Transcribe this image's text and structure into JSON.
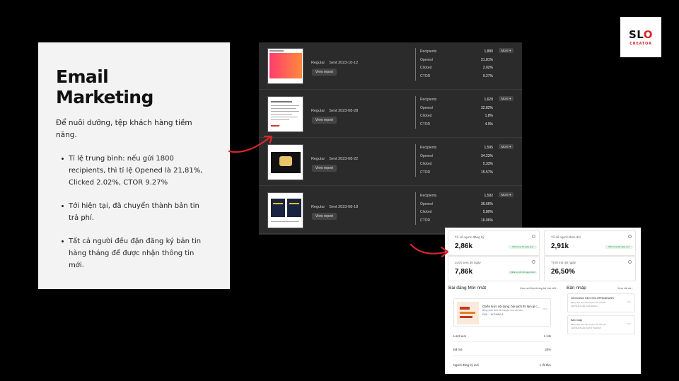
{
  "info": {
    "title": "Email Marketing",
    "subtitle": "Để nuôi dưỡng, tệp khách hàng tiềm năng.",
    "bullets": [
      "Tỉ lệ trung bình: nếu gửi 1800 recipients, thì tỉ lệ Opened là 21,81%, Clicked 2.02%, CTOR 9.27%",
      "Tới hiện tại, đã chuyển thành bản tin trả phí.",
      "Tất cả người đều đặn đăng ký bản tin hàng tháng để được nhận thông tin mới."
    ]
  },
  "logo": {
    "main_s": "S",
    "main_o": "O",
    "main_l": "L",
    "main_o2": "O",
    "sub": "CREATOR"
  },
  "colors": {
    "accent_red": "#d8262c",
    "panel_dark": "#2b2b2b",
    "badge_green": "#2a8a46"
  },
  "emails": {
    "type_label": "Regular",
    "view_label": "View report",
    "more_label": "More ▾",
    "stat_labels": [
      "Recipients",
      "Opened",
      "Clicked",
      "CTOR"
    ],
    "rows": [
      {
        "sent": "Sent 2023-10-12",
        "values": [
          "1,880",
          "21.81%",
          "2.02%",
          "9.27%"
        ]
      },
      {
        "sent": "Sent 2023-08-28",
        "values": [
          "1,628",
          "32.82%",
          "1.8%",
          "4.9%"
        ]
      },
      {
        "sent": "Sent 2023-08-22",
        "values": [
          "1,595",
          "34.23%",
          "5.33%",
          "15.57%"
        ]
      },
      {
        "sent": "Sent 2023-08-18",
        "values": [
          "1,592",
          "36.66%",
          "5.80%",
          "16.06%"
        ]
      }
    ]
  },
  "dashboard": {
    "kpis": [
      {
        "label": "Tổ số người đăng ký",
        "value": "2,86k",
        "badge": "436 trong 30 ngày qua"
      },
      {
        "label": "Tổ số người theo dõi",
        "value": "2,91k",
        "badge": "387 trong 30 ngày qua"
      },
      {
        "label": "Lượt xem 30 ngày",
        "value": "7,86k",
        "badge": "4,96k so với 30 ngày trước"
      },
      {
        "label": "Tỷ lệ mở 30 ngày",
        "value": "26,50%",
        "badge": ""
      }
    ],
    "recent_title": "Bài đăng Mới nhất",
    "recent_link": "Xem số liệu thống kê bài viết ›",
    "post": {
      "title": "Chiến lược nội dung: bài sách thì làm gì c...",
      "sub": "Bằng cách theo dõi chuyện nhỏ của bạn",
      "tag": "PAID",
      "date": "16 THÁNG 5"
    },
    "metrics": [
      {
        "label": "Lượt xem",
        "value": "1.14k"
      },
      {
        "label": "Đã mở",
        "value": "25%"
      },
      {
        "label": "Người đăng ký mới",
        "value": "1 rồi tắm"
      }
    ],
    "drafts_title": "Bản nháp",
    "drafts_link": "Xem tất cả ›",
    "drafts": [
      {
        "title": "NỘI DUNG SEO SOLOPRENEURS",
        "l1": "Bằng cách theo dõi chuyện nhỏ của bạn",
        "l2": "CẬP NHẬT LẦN CUỐI 4NGÀY"
      },
      {
        "title": "Bản nháp",
        "l1": "Bằng cách theo dõi chuyện nhỏ của bạn",
        "l2": "CẬP NHẬT LẦN CUỐI 3 THÁNG 5"
      }
    ]
  }
}
